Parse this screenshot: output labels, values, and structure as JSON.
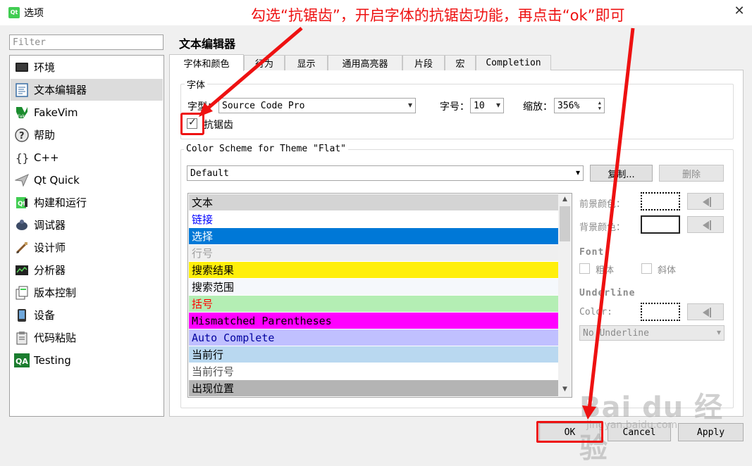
{
  "window": {
    "title": "选项",
    "logo": "Qt",
    "close_icon": "✕"
  },
  "annotation": {
    "text": "勾选“抗锯齿”，开启字体的抗锯齿功能，再点击“ok”即可",
    "color": "#ee1111"
  },
  "filter": {
    "placeholder": "Filter",
    "value": ""
  },
  "categories": [
    {
      "label": "环境",
      "icon": "monitor-icon",
      "selected": false
    },
    {
      "label": "文本编辑器",
      "icon": "text-editor-icon",
      "selected": true
    },
    {
      "label": "FakeVim",
      "icon": "fakevim-icon",
      "selected": false
    },
    {
      "label": "帮助",
      "icon": "help-icon",
      "selected": false
    },
    {
      "label": "C++",
      "icon": "cpp-braces-icon",
      "selected": false
    },
    {
      "label": "Qt Quick",
      "icon": "qt-quick-icon",
      "selected": false
    },
    {
      "label": "构建和运行",
      "icon": "build-run-icon",
      "selected": false
    },
    {
      "label": "调试器",
      "icon": "debugger-icon",
      "selected": false
    },
    {
      "label": "设计师",
      "icon": "designer-icon",
      "selected": false
    },
    {
      "label": "分析器",
      "icon": "analyzer-icon",
      "selected": false
    },
    {
      "label": "版本控制",
      "icon": "version-control-icon",
      "selected": false
    },
    {
      "label": "设备",
      "icon": "device-icon",
      "selected": false
    },
    {
      "label": "代码粘贴",
      "icon": "code-paste-icon",
      "selected": false
    },
    {
      "label": "Testing",
      "icon": "qa-testing-icon",
      "selected": false
    }
  ],
  "page": {
    "title": "文本编辑器",
    "tabs": [
      {
        "label": "字体和颜色",
        "active": true
      },
      {
        "label": "行为",
        "active": false
      },
      {
        "label": "显示",
        "active": false
      },
      {
        "label": "通用高亮器",
        "active": false
      },
      {
        "label": "片段",
        "active": false
      },
      {
        "label": "宏",
        "active": false
      },
      {
        "label": "Completion",
        "active": false
      }
    ]
  },
  "font_group": {
    "title": "字体",
    "family_label": "字型：",
    "family_value": "Source Code Pro",
    "size_label": "字号：",
    "size_value": "10",
    "zoom_label": "缩放：",
    "zoom_value": "356%",
    "antialias_label": "抗锯齿",
    "antialias_checked": true
  },
  "scheme_group": {
    "title": "Color Scheme for Theme \"Flat\"",
    "scheme_value": "Default",
    "copy_label": "复制...",
    "delete_label": "删除",
    "items": [
      {
        "label": "文本",
        "bg": "#d4d4d4",
        "fg": "#000000",
        "mono": false
      },
      {
        "label": "链接",
        "bg": "#ffffff",
        "fg": "#0000ff",
        "mono": false
      },
      {
        "label": "选择",
        "bg": "#0078d7",
        "fg": "#ffffff",
        "mono": false
      },
      {
        "label": "行号",
        "bg": "#efefef",
        "fg": "#9f9f9f",
        "mono": false
      },
      {
        "label": "搜索结果",
        "bg": "#ffef0b",
        "fg": "#000000",
        "mono": false
      },
      {
        "label": "搜索范围",
        "bg": "#f5f8fc",
        "fg": "#000000",
        "mono": false
      },
      {
        "label": "括号",
        "bg": "#b4eeb4",
        "fg": "#ff0000",
        "mono": false
      },
      {
        "label": "Mismatched Parentheses",
        "bg": "#ff00ff",
        "fg": "#000000",
        "mono": true
      },
      {
        "label": "Auto Complete",
        "bg": "#c0c0ff",
        "fg": "#0000a0",
        "mono": true
      },
      {
        "label": "当前行",
        "bg": "#b9d8f0",
        "fg": "#000000",
        "mono": false
      },
      {
        "label": "当前行号",
        "bg": "#ffffff",
        "fg": "#505050",
        "mono": false
      },
      {
        "label": "出现位置",
        "bg": "#b4b4b4",
        "fg": "#000000",
        "mono": false
      }
    ]
  },
  "properties": {
    "foreground_label": "前景颜色：",
    "background_label": "背景颜色：",
    "font_heading": "Font",
    "bold_label": "粗体",
    "italic_label": "斜体",
    "underline_heading": "Underline",
    "underline_color_label": "Color:",
    "underline_style_value": "No Underline"
  },
  "dialog_buttons": {
    "ok": "OK",
    "cancel": "Cancel",
    "apply": "Apply"
  },
  "watermark": {
    "logo": "Bai du 经验",
    "url": "jingyan.baidu.com"
  }
}
